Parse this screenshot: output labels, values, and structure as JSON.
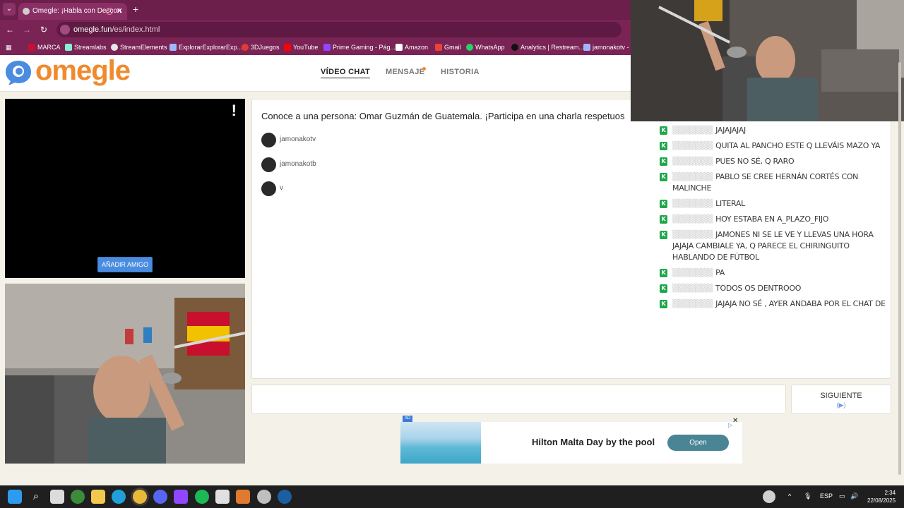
{
  "browser": {
    "tab_title": "Omegle: ¡Habla con Descon",
    "url_host": "omegle.fun",
    "url_path": "/es/index.html",
    "bookmarks": [
      "MARCA",
      "Streamlabs",
      "StreamElements",
      "ExplorarExplorarExp...",
      "3DJuegos",
      "YouTube",
      "Prime Gaming - Pág...",
      "Amazon",
      "Gmail",
      "WhatsApp",
      "Analytics | Restream...",
      "jamonakotv - T"
    ]
  },
  "header": {
    "logo": "omegle",
    "nav": [
      "VÍDEO CHAT",
      "MENSAJE",
      "HISTORIA"
    ]
  },
  "stranger_video": {
    "report_label": "!",
    "add_friend_label": "AÑADIR AMIGO"
  },
  "chat": {
    "intro": "Conoce a una persona: Omar Guzmán de Guatemala. ¡Participa en una charla respetuos",
    "users": [
      "jamonakotv",
      "jamonakotb",
      "v"
    ]
  },
  "controls": {
    "next_label": "SIGUIENTE",
    "next_hint": "(▶)"
  },
  "ad": {
    "badge": "AD",
    "title": "Hilton Malta Day by the pool",
    "button": "Open"
  },
  "stream_chat": [
    {
      "text": "JAJAJAJAJ"
    },
    {
      "text": "QUITA AL PANCHO ESTE Q LLEVÁIS MAZO YA"
    },
    {
      "text": "PUES NO SÉ, Q RARO"
    },
    {
      "text": "PABLO SE CREE HERNÁN CORTÉS CON MALINCHE"
    },
    {
      "text": "LITERAL"
    },
    {
      "text": "HOY ESTABA EN A_PLAZO_FIJO"
    },
    {
      "text": "JAMONES NI SE LE VE Y LLEVAS UNA HORA JAJAJA CAMBIALE YA, Q PARECE EL CHIRINGUITO HABLANDO DE FÚTBOL"
    },
    {
      "text": "PA"
    },
    {
      "text": "TODOS OS DENTROOO"
    },
    {
      "text": "JAJAJA NO SÉ , AYER ANDABA POR EL CHAT DE SIMON"
    }
  ],
  "taskbar": {
    "lang": "ESP",
    "time": "2:34",
    "date": "22/08/2025"
  },
  "colors": {
    "browser_chrome": "#7a2456",
    "logo_orange": "#f08a2c",
    "logo_blue": "#4a8ce0",
    "page_bg": "#f4f1e8",
    "chat_icon_green": "#1ea84a"
  }
}
